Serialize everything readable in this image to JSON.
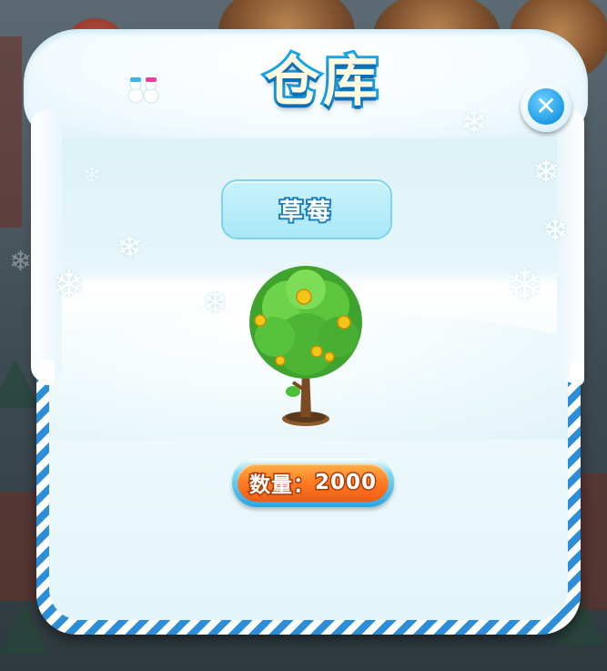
{
  "dialog": {
    "title": "仓库",
    "close_icon": "close-icon",
    "item_name": "草莓",
    "quantity_label": "数量：",
    "quantity_value": "2000"
  },
  "colors": {
    "frame_stripe": "#2c8ed8",
    "title_outline": "#1aa3e8",
    "button_orange": "#ff7b22",
    "close_blue": "#1e9be8"
  },
  "icons": [
    "close-icon",
    "snowflake-icon",
    "snowman-icon",
    "tree-icon"
  ]
}
